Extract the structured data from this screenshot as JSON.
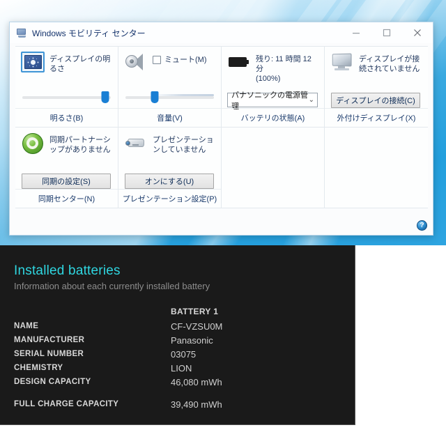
{
  "window": {
    "title": "Windows モビリティ センター",
    "app_icon": "mobility-center-icon",
    "minimize_label": "最小化",
    "maximize_label": "最大化",
    "close_label": "閉じる",
    "help_label": "?"
  },
  "tiles": [
    {
      "id": "brightness",
      "icon": "brightness-icon",
      "label": "ディスプレイの明るさ",
      "footer": "明るさ(B)",
      "slider_value": 94
    },
    {
      "id": "volume",
      "icon": "speaker-icon",
      "label": "",
      "checkbox_label": "ミュート(M)",
      "checkbox_checked": false,
      "footer": "音量(V)",
      "slider_value": 33
    },
    {
      "id": "battery",
      "icon": "battery-icon",
      "label": "残り: 11 時間 12 分 (100%)",
      "label_line1": "残り: 11 時間 12 分",
      "label_line2": "(100%)",
      "combo_value": "パナソニックの電源管理",
      "combo_chevron": "⌄",
      "footer": "バッテリの状態(A)"
    },
    {
      "id": "external-display",
      "icon": "monitor-icon",
      "label": "ディスプレイが接続されていません",
      "button_label": "ディスプレイの接続(C)",
      "footer": "外付けディスプレイ(X)"
    },
    {
      "id": "sync-center",
      "icon": "sync-icon",
      "label": "同期パートナーシップがありません",
      "button_label": "同期の設定(S)",
      "footer": "同期センター(N)"
    },
    {
      "id": "presentation",
      "icon": "projector-icon",
      "label": "プレゼンテーションしていません",
      "button_label": "オンにする(U)",
      "footer": "プレゼンテーション設定(P)"
    }
  ],
  "battery_report": {
    "title": "Installed batteries",
    "subtitle": "Information about each currently installed battery",
    "column_header": "BATTERY 1",
    "rows": [
      {
        "key": "NAME",
        "value": "CF-VZSU0M"
      },
      {
        "key": "MANUFACTURER",
        "value": "Panasonic"
      },
      {
        "key": "SERIAL NUMBER",
        "value": "03075"
      },
      {
        "key": "CHEMISTRY",
        "value": "LION"
      },
      {
        "key": "DESIGN CAPACITY",
        "value": "46,080 mWh"
      },
      {
        "key": "FULL CHARGE CAPACITY",
        "value": "39,490 mWh"
      }
    ]
  },
  "colors": {
    "accent_cyan": "#2fd6e0",
    "panel_bg": "#1a1a1a",
    "slider_thumb": "#1a7fd4",
    "title_text": "#13326b",
    "desktop_blue": "#2ea4e0"
  }
}
